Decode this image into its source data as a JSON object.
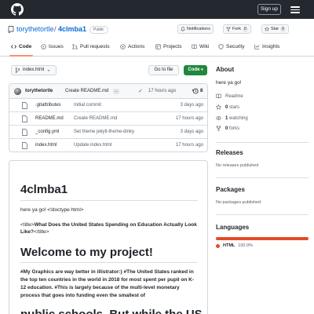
{
  "header": {
    "signup_label": "Sign up",
    "logo_icon": "github-logo-icon",
    "menu_icon": "hamburger-icon"
  },
  "repo": {
    "owner": "torythetortle",
    "separator": "/",
    "name": "4clmba1",
    "visibility": "Public",
    "notifications_label": "Notifications",
    "fork_label": "Fork",
    "fork_count": "0",
    "star_label": "Star",
    "star_count": "0"
  },
  "tabs": [
    {
      "label": "Code",
      "icon": "code-icon"
    },
    {
      "label": "Issues",
      "icon": "issue-icon"
    },
    {
      "label": "Pull requests",
      "icon": "pull-request-icon"
    },
    {
      "label": "Actions",
      "icon": "play-icon"
    },
    {
      "label": "Projects",
      "icon": "table-icon"
    },
    {
      "label": "Wiki",
      "icon": "book-icon"
    },
    {
      "label": "Security",
      "icon": "shield-icon"
    },
    {
      "label": "Insights",
      "icon": "graph-icon"
    }
  ],
  "toolbar": {
    "branch_label": "index.html",
    "goto_label": "Go to file",
    "code_label": "Code"
  },
  "latest_commit": {
    "author": "torythetortle",
    "message": "Create README.md",
    "more": "...",
    "time": "17 hours ago",
    "history_count": "8"
  },
  "files": [
    {
      "name": ".gitattributes",
      "commit": "Initial commit",
      "time": "3 days ago"
    },
    {
      "name": "README.md",
      "commit": "Create README.md",
      "time": "17 hours ago"
    },
    {
      "name": "_config.yml",
      "commit": "Set theme jekyll-theme-dinky",
      "time": "3 days ago"
    },
    {
      "name": "index.html",
      "commit": "Update index.html",
      "time": "17 hours ago"
    }
  ],
  "readme": {
    "title": "4clmba1",
    "line1": "here ya go! <!doctype html>",
    "title_tag_open": "<title>",
    "title_tag_text": "What Does the United States Spending on Education Actually Look Like?",
    "title_tag_close": "</title>",
    "heading2": "Welcome to my project!",
    "paragraph": "#My Graphics are way better in illistrator:) #The United States ranked in the top ten countries in the world in 2018 for most spent per pupil on K-12 education. #This is largely because of the multi-level monetary process that goes into funding even the smallest of",
    "heading3": "public schools. But while the US"
  },
  "sidebar": {
    "about_title": "About",
    "description": "here ya go!",
    "readme_label": "Readme",
    "stars_count": "0",
    "stars_label": "stars",
    "watching_count": "1",
    "watching_label": "watching",
    "forks_count": "0",
    "forks_label": "forks",
    "releases_title": "Releases",
    "releases_empty": "No releases published",
    "packages_title": "Packages",
    "packages_empty": "No packages published",
    "languages_title": "Languages",
    "language_name": "HTML",
    "language_pct": "100.0%",
    "language_color": "#e34c26"
  }
}
